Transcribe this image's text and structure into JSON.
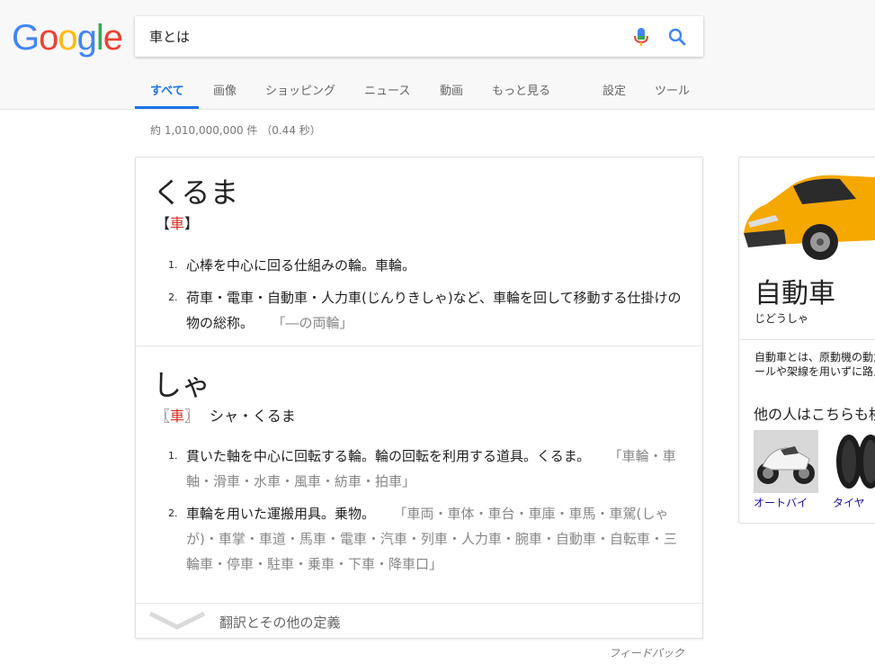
{
  "logo": {
    "text": "Google"
  },
  "search": {
    "query": "車とは"
  },
  "tabs": [
    {
      "label": "すべて"
    },
    {
      "label": "画像"
    },
    {
      "label": "ショッピング"
    },
    {
      "label": "ニュース"
    },
    {
      "label": "動画"
    },
    {
      "label": "もっと見る"
    },
    {
      "label": "設定"
    },
    {
      "label": "ツール"
    }
  ],
  "result_stats": "約 1,010,000,000 件 （0.44 秒）",
  "dictionary": {
    "entries": [
      {
        "word": "くるま",
        "kanji": "車",
        "bracket_open": "【",
        "bracket_close": "】",
        "reading": "",
        "definitions": [
          {
            "num": "1.",
            "text": "心棒を中心に回る仕組みの輪。車輪。",
            "example": ""
          },
          {
            "num": "2.",
            "text": "荷車・電車・自動車・人力車(じんりきしゃ)など、車輪を回して移動する仕掛けの物の総称。",
            "example": "「―の両輪」"
          }
        ]
      },
      {
        "word": "しゃ",
        "kanji": "車",
        "bracket_open": "〖",
        "bracket_close": "〗",
        "reading": "シャ・くるま",
        "definitions": [
          {
            "num": "1.",
            "text": "貫いた軸を中心に回転する輪。輪の回転を利用する道具。くるま。",
            "example": "「車輪・車軸・滑車・水車・風車・紡車・拍車」"
          },
          {
            "num": "2.",
            "text": "車輪を用いた運搬用具。乗物。",
            "example": "「車両・車体・車台・車庫・車馬・車駕(しゃが)・車掌・車道・馬車・電車・汽車・列車・人力車・腕車・自動車・自転車・三輪車・停車・駐車・乗車・下車・降車口」"
          }
        ]
      }
    ],
    "more_label": "翻訳とその他の定義"
  },
  "feedback": "フィードバック",
  "knowledge_panel": {
    "title": "自動車",
    "subtitle": "じどうしゃ",
    "description": "自動車とは、原動機の動力によって車輪を回転させ、レールや架線を用いずに路上を走る車のことである。",
    "also_searched": "他の人はこちらも検索",
    "thumbnails": [
      {
        "label": "オートバイ",
        "icon": "motorcycle-icon"
      },
      {
        "label": "タイヤ",
        "icon": "tire-icon"
      }
    ]
  },
  "colors": {
    "accent_blue": "#1a73e8",
    "kanji_red": "#d93025",
    "car_yellow": "#f5a800",
    "link_blue": "#1a0dab"
  }
}
